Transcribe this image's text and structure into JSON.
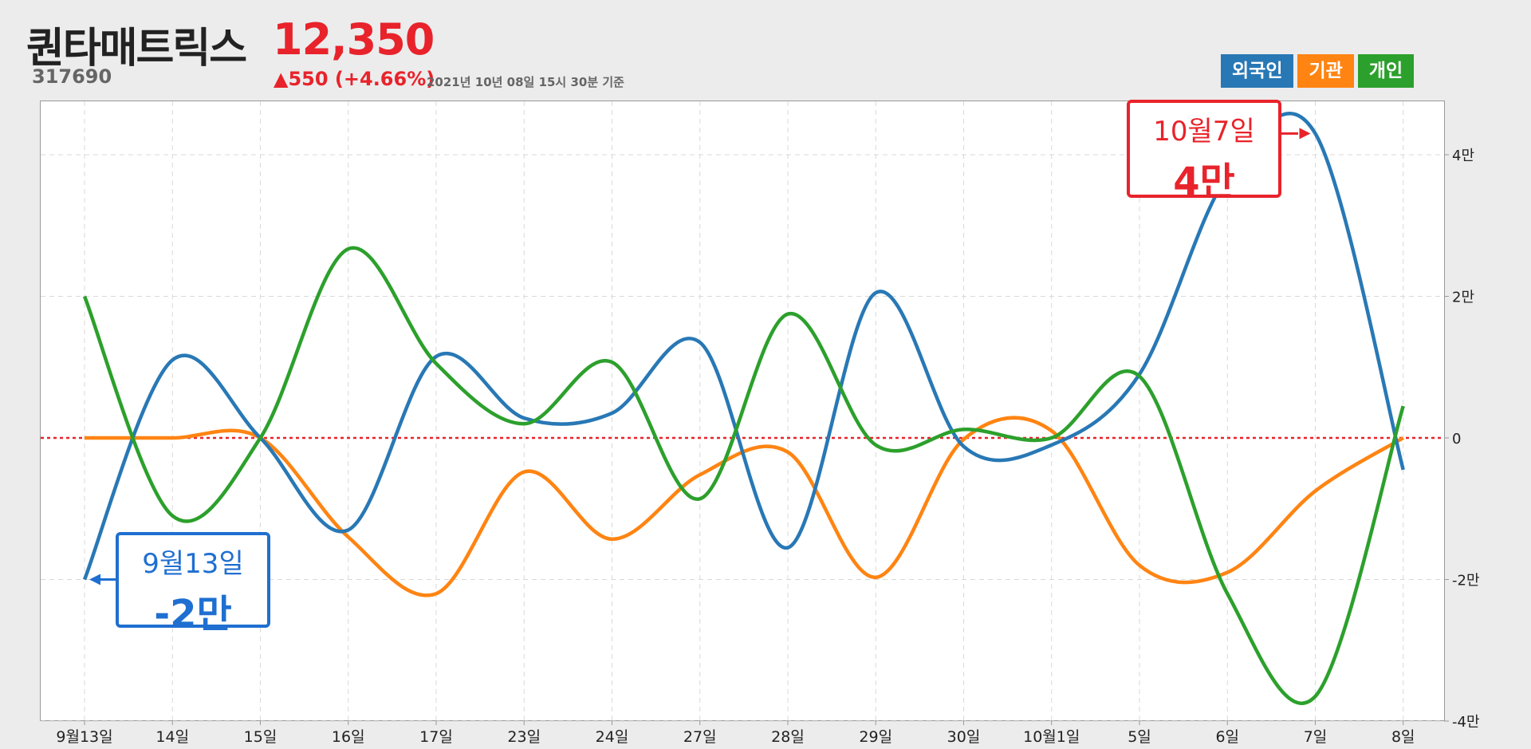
{
  "header": {
    "name": "퀀타매트릭스",
    "code": "317690",
    "price": "12,350",
    "change": "▲550 (+4.66%)",
    "time": "2021년 10년 08일 15시 30분 기준"
  },
  "legend": [
    {
      "label": "외국인",
      "color": "#2878b5"
    },
    {
      "label": "기관",
      "color": "#ff8412"
    },
    {
      "label": "개인",
      "color": "#2ca02c"
    }
  ],
  "callouts": {
    "min": {
      "date": "9월13일",
      "value": "-2만",
      "color": "#1f6fd1"
    },
    "max": {
      "date": "10월7일",
      "value": "4만",
      "color": "#e8232b"
    }
  },
  "chart_data": {
    "type": "line",
    "categories": [
      "9월13일",
      "14일",
      "15일",
      "16일",
      "17일",
      "23일",
      "24일",
      "27일",
      "28일",
      "29일",
      "30일",
      "10월1일",
      "5일",
      "6일",
      "7일",
      "8일"
    ],
    "ylim": [
      -4,
      4.2
    ],
    "yticks": [
      -4,
      -2,
      0,
      2,
      4
    ],
    "ytick_labels": [
      "-4만",
      "-2만",
      "0",
      "2만",
      "4만"
    ],
    "y_unit": "만",
    "grid": true,
    "legend_position": "top-right",
    "zero_line_color": "#e8232b",
    "series": [
      {
        "name": "외국인",
        "color": "#2878b5",
        "values": [
          -2.0,
          1.1,
          0.0,
          -1.3,
          1.15,
          0.28,
          0.35,
          1.35,
          -1.55,
          2.05,
          -0.12,
          -0.1,
          0.9,
          3.7,
          4.3,
          -0.45
        ]
      },
      {
        "name": "기관",
        "color": "#ff8412",
        "values": [
          0.0,
          0.0,
          0.0,
          -1.4,
          -2.2,
          -0.48,
          -1.43,
          -0.52,
          -0.2,
          -1.97,
          -0.02,
          0.1,
          -1.8,
          -1.9,
          -0.75,
          0.0
        ]
      },
      {
        "name": "개인",
        "color": "#2ca02c",
        "values": [
          2.0,
          -1.1,
          0.0,
          2.67,
          1.05,
          0.2,
          1.07,
          -0.86,
          1.75,
          -0.1,
          0.12,
          0.0,
          0.87,
          -2.2,
          -3.65,
          0.45
        ]
      }
    ]
  }
}
